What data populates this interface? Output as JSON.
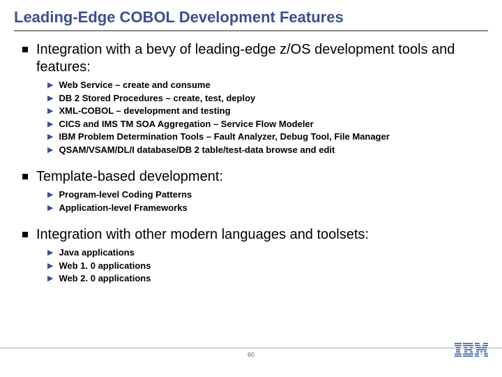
{
  "title": "Leading-Edge COBOL Development Features",
  "sections": [
    {
      "heading": "Integration with a bevy of leading-edge z/OS development tools and features:",
      "items": [
        "Web Service – create and consume",
        "DB 2 Stored Procedures – create, test, deploy",
        "XML-COBOL – development and testing",
        "CICS and IMS TM SOA Aggregation – Service Flow Modeler",
        "IBM Problem Determination Tools – Fault Analyzer, Debug Tool, File Manager",
        "QSAM/VSAM/DL/I database/DB 2 table/test-data browse and edit"
      ]
    },
    {
      "heading": "Template-based development:",
      "items": [
        "Program-level Coding Patterns",
        "Application-level Frameworks"
      ]
    },
    {
      "heading": "Integration with other modern languages and toolsets:",
      "items": [
        "Java applications",
        "Web 1. 0 applications",
        "Web 2. 0 applications"
      ]
    }
  ],
  "page_number": "60",
  "logo_text": "IBM"
}
